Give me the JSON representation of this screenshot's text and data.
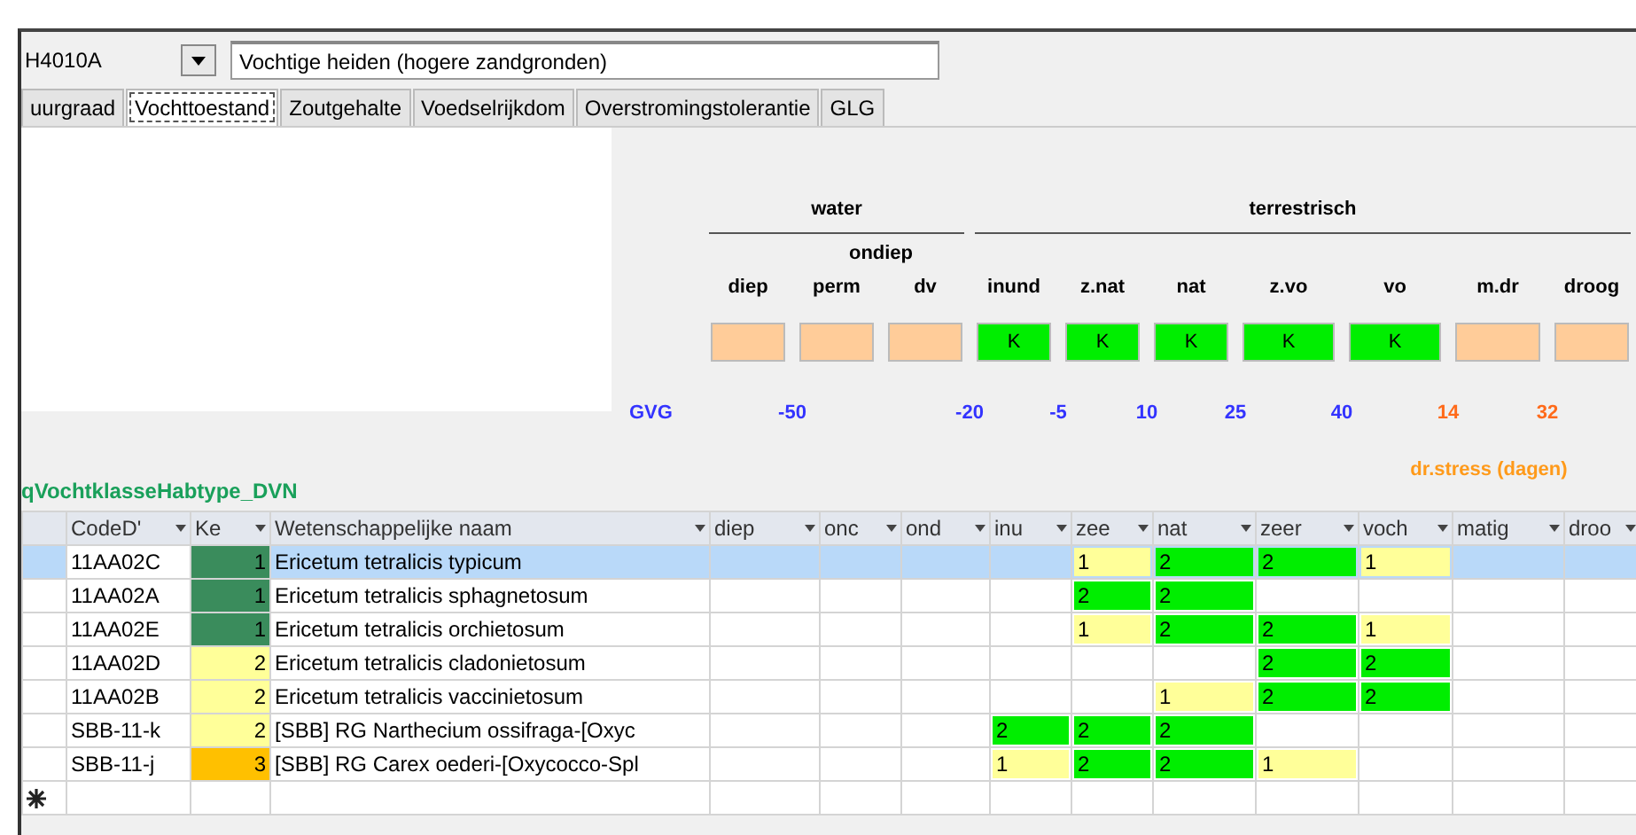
{
  "habitat_selector": {
    "value": "H4010A"
  },
  "habitat_name": {
    "value": "Vochtige heiden (hogere zandgronden)"
  },
  "tabs": [
    {
      "label": "uurgraad",
      "selected": false
    },
    {
      "label": "Vochttoestand",
      "selected": true
    },
    {
      "label": "Zoutgehalte",
      "selected": false
    },
    {
      "label": "Voedselrijkdom",
      "selected": false
    },
    {
      "label": "Overstromingstolerantie",
      "selected": false
    },
    {
      "label": "GLG",
      "selected": false
    }
  ],
  "moisture_panel": {
    "groups": [
      {
        "label": "water",
        "classes": [
          {
            "label": "diep",
            "color": "#ffcc99",
            "limit": {
              "text": "-50",
              "color": "#3333ff"
            }
          },
          {
            "label": "ondiep",
            "children": [
              {
                "label": "perm",
                "color": "#ffcc99"
              },
              {
                "label": "dv",
                "color": "#ffcc99",
                "limit": {
                  "text": "-20",
                  "color": "#3333ff"
                }
              }
            ]
          }
        ]
      },
      {
        "label": "terrestrisch",
        "classes": [
          {
            "label": "inund",
            "color": "#00ee00",
            "mark": "K",
            "limit": {
              "text": "-5",
              "color": "#3333ff"
            }
          },
          {
            "label": "z.nat",
            "color": "#00ee00",
            "mark": "K",
            "limit": {
              "text": "10",
              "color": "#3333ff"
            }
          },
          {
            "label": "nat",
            "color": "#00ee00",
            "mark": "K",
            "limit": {
              "text": "25",
              "color": "#3333ff"
            }
          },
          {
            "label": "z.vo",
            "color": "#00ee00",
            "mark": "K",
            "limit": {
              "text": "40",
              "color": "#3333ff"
            }
          },
          {
            "label": "vo",
            "color": "#00ee00",
            "mark": "K",
            "limit": {
              "text": "14",
              "color": "#ff6a1a"
            }
          },
          {
            "label": "m.dr",
            "color": "#ffcc99",
            "limit": {
              "text": "32",
              "color": "#ff6a1a"
            }
          },
          {
            "label": "droog",
            "color": "#ffcc99"
          }
        ]
      }
    ],
    "gvg_label": "GVG",
    "stress_caption": "dr.stress (dagen)"
  },
  "table": {
    "title": "qVochtklasseHabtype_DVN",
    "columns": [
      "CodeD'",
      "Ke",
      "Wetenschappelijke naam",
      "diep",
      "onc",
      "ond",
      "inu",
      "zee",
      "nat",
      "zeer",
      "voch",
      "matig",
      "droo"
    ],
    "rows": [
      {
        "selected": true,
        "code": "11AA02C",
        "ke": {
          "text": "1",
          "color": "#3a8c5c"
        },
        "name": "Ericetum tetralicis typicum",
        "grades": [
          {
            "kind": "blank"
          },
          {
            "kind": "blank"
          },
          {
            "kind": "blank"
          },
          {
            "kind": "blank"
          },
          {
            "kind": "score",
            "text": "1",
            "color": "#ffff99"
          },
          {
            "kind": "score",
            "text": "2",
            "color": "#00ee00"
          },
          {
            "kind": "score",
            "text": "2",
            "color": "#00ee00"
          },
          {
            "kind": "score",
            "text": "1",
            "color": "#ffff99"
          },
          {
            "kind": "blank"
          },
          {
            "kind": "blank"
          }
        ]
      },
      {
        "selected": false,
        "code": "11AA02A",
        "ke": {
          "text": "1",
          "color": "#3a8c5c"
        },
        "name": "Ericetum tetralicis sphagnetosum",
        "grades": [
          {
            "kind": "blank"
          },
          {
            "kind": "blank"
          },
          {
            "kind": "blank"
          },
          {
            "kind": "blank"
          },
          {
            "kind": "score",
            "text": "2",
            "color": "#00ee00"
          },
          {
            "kind": "score",
            "text": "2",
            "color": "#00ee00"
          },
          {
            "kind": "blank"
          },
          {
            "kind": "blank"
          },
          {
            "kind": "blank"
          },
          {
            "kind": "blank"
          }
        ]
      },
      {
        "selected": false,
        "code": "11AA02E",
        "ke": {
          "text": "1",
          "color": "#3a8c5c"
        },
        "name": "Ericetum tetralicis orchietosum",
        "grades": [
          {
            "kind": "blank"
          },
          {
            "kind": "blank"
          },
          {
            "kind": "blank"
          },
          {
            "kind": "blank"
          },
          {
            "kind": "score",
            "text": "1",
            "color": "#ffff99"
          },
          {
            "kind": "score",
            "text": "2",
            "color": "#00ee00"
          },
          {
            "kind": "score",
            "text": "2",
            "color": "#00ee00"
          },
          {
            "kind": "score",
            "text": "1",
            "color": "#ffff99"
          },
          {
            "kind": "blank"
          },
          {
            "kind": "blank"
          }
        ]
      },
      {
        "selected": false,
        "code": "11AA02D",
        "ke": {
          "text": "2",
          "color": "#ffff99"
        },
        "name": "Ericetum tetralicis cladonietosum",
        "grades": [
          {
            "kind": "blank"
          },
          {
            "kind": "blank"
          },
          {
            "kind": "blank"
          },
          {
            "kind": "blank"
          },
          {
            "kind": "blank"
          },
          {
            "kind": "blank"
          },
          {
            "kind": "score",
            "text": "2",
            "color": "#00ee00"
          },
          {
            "kind": "score",
            "text": "2",
            "color": "#00ee00"
          },
          {
            "kind": "blank"
          },
          {
            "kind": "blank"
          }
        ]
      },
      {
        "selected": false,
        "code": "11AA02B",
        "ke": {
          "text": "2",
          "color": "#ffff99"
        },
        "name": "Ericetum tetralicis vaccinietosum",
        "grades": [
          {
            "kind": "blank"
          },
          {
            "kind": "blank"
          },
          {
            "kind": "blank"
          },
          {
            "kind": "blank"
          },
          {
            "kind": "blank"
          },
          {
            "kind": "score",
            "text": "1",
            "color": "#ffff99"
          },
          {
            "kind": "score",
            "text": "2",
            "color": "#00ee00"
          },
          {
            "kind": "score",
            "text": "2",
            "color": "#00ee00"
          },
          {
            "kind": "blank"
          },
          {
            "kind": "blank"
          }
        ]
      },
      {
        "selected": false,
        "code": "SBB-11-k",
        "ke": {
          "text": "2",
          "color": "#ffff99"
        },
        "name": "[SBB] RG Narthecium ossifraga-[Oxyc",
        "grades": [
          {
            "kind": "blank"
          },
          {
            "kind": "blank"
          },
          {
            "kind": "blank"
          },
          {
            "kind": "score",
            "text": "2",
            "color": "#00ee00"
          },
          {
            "kind": "score",
            "text": "2",
            "color": "#00ee00"
          },
          {
            "kind": "score",
            "text": "2",
            "color": "#00ee00"
          },
          {
            "kind": "blank"
          },
          {
            "kind": "blank"
          },
          {
            "kind": "blank"
          },
          {
            "kind": "blank"
          }
        ]
      },
      {
        "selected": false,
        "code": "SBB-11-j",
        "ke": {
          "text": "3",
          "color": "#ffc000"
        },
        "name": "[SBB] RG Carex oederi-[Oxycocco-Spl",
        "grades": [
          {
            "kind": "blank"
          },
          {
            "kind": "blank"
          },
          {
            "kind": "blank"
          },
          {
            "kind": "score",
            "text": "1",
            "color": "#ffff99"
          },
          {
            "kind": "score",
            "text": "2",
            "color": "#00ee00"
          },
          {
            "kind": "score",
            "text": "2",
            "color": "#00ee00"
          },
          {
            "kind": "score",
            "text": "1",
            "color": "#ffff99"
          },
          {
            "kind": "blank"
          },
          {
            "kind": "blank"
          },
          {
            "kind": "blank"
          }
        ]
      }
    ]
  }
}
